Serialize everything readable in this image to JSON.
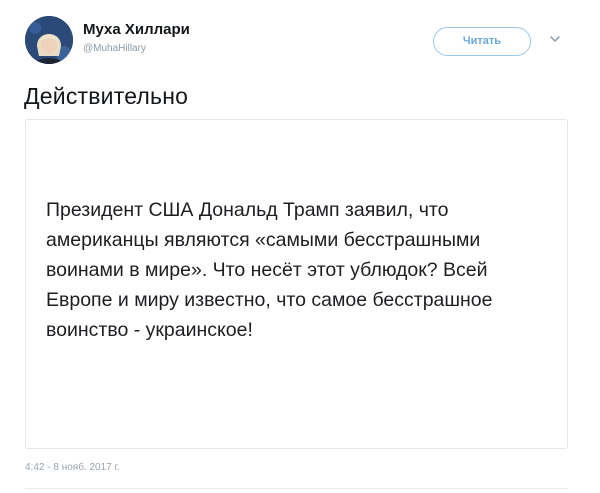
{
  "user": {
    "display_name": "Муха Хиллари",
    "handle": "@MuhaHillary"
  },
  "header": {
    "follow_label": "Читать",
    "more_icon": "chevron-down-icon"
  },
  "tweet": {
    "text": "Действительно",
    "image_text": "Президент США Дональд Трамп заявил, что американцы являются «самыми бесстрашными воинами в мире». Что несёт этот ублюдок? Всей Европе и миру известно, что самое бесстрашное воинство - украинское!",
    "timestamp": "4:42 - 8 нояб. 2017 г."
  },
  "colors": {
    "follow_accent": "#6aa7d8",
    "follow_border": "#9ec9ec",
    "muted_text": "#8f9aa3"
  }
}
